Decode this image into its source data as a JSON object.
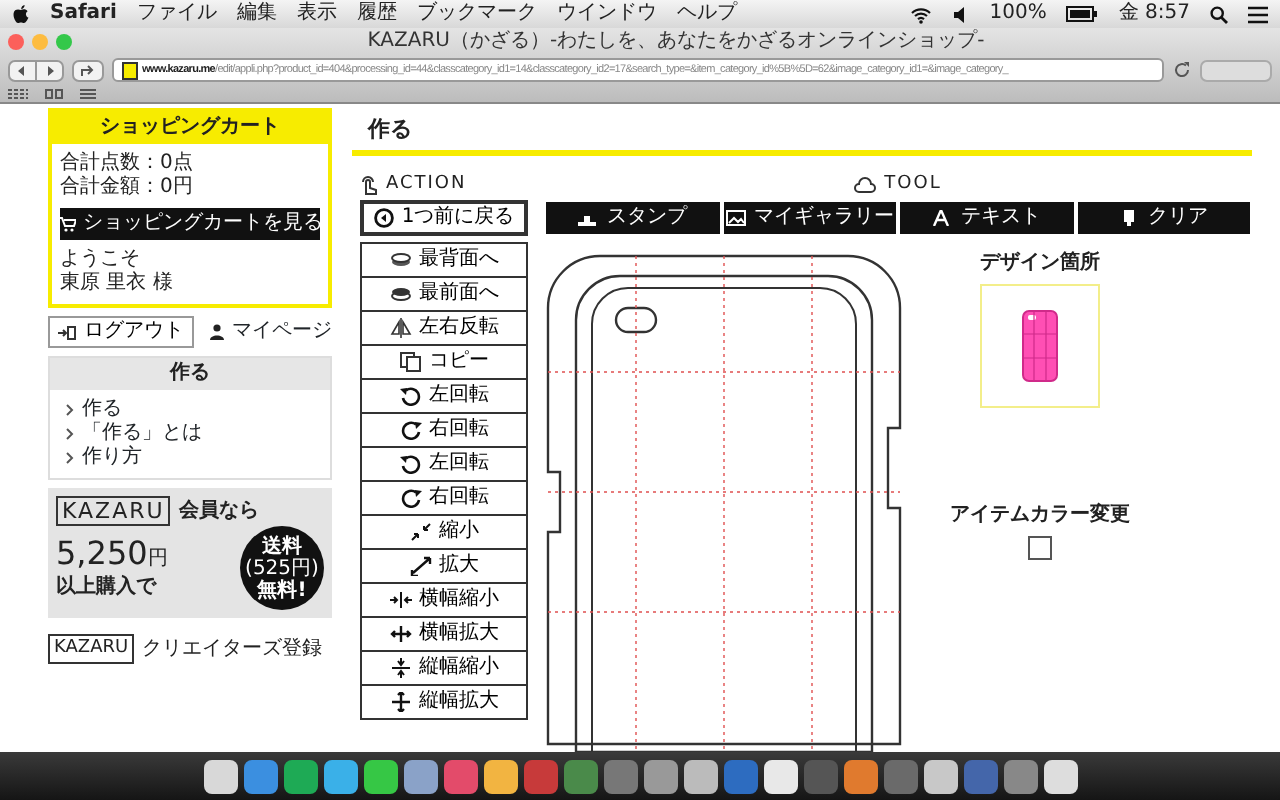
{
  "menu_bar": {
    "items": [
      "Safari",
      "ファイル",
      "編集",
      "表示",
      "履歴",
      "ブックマーク",
      "ウインドウ",
      "ヘルプ"
    ],
    "battery": "100%",
    "clock": "金 8:57"
  },
  "window": {
    "title": "KAZARU（かざる）-わたしを、あなたをかざるオンラインショップ-"
  },
  "address_bar": {
    "host": "www.kazaru.me",
    "path": "/edit/appli.php?product_id=404&processing_id=44&classcategory_id1=14&classcategory_id2=17&search_type=&item_category_id%5B%5D=62&image_category_id1=&image_category_"
  },
  "sidebar": {
    "cart": {
      "title": "ショッピングカート",
      "total_items": "合計点数：0点",
      "total_price": "合計金額：0円",
      "view_button": "ショッピングカートを見る",
      "welcome": "ようこそ",
      "user": "東原 里衣 様"
    },
    "logout": "ログアウト",
    "mypage": "マイページ",
    "menu": {
      "title": "作る",
      "links": [
        "作る",
        "「作る」とは",
        "作り方"
      ]
    },
    "banner": {
      "logo": "KAZARU",
      "member": "会員なら",
      "amount": "5,250",
      "unit": "円",
      "condition": "以上購入で",
      "badge": [
        "送料",
        "(525円)",
        "無料!"
      ]
    },
    "creators": {
      "logo": "KAZARU",
      "label": "クリエイターズ登録"
    }
  },
  "page": {
    "title": "作る"
  },
  "action": {
    "heading": "ACTION",
    "back": "1つ前に戻る",
    "buttons": [
      "最背面へ",
      "最前面へ",
      "左右反転",
      "コピー",
      "左回転",
      "右回転",
      "左回転",
      "右回転",
      "縮小",
      "拡大",
      "横幅縮小",
      "横幅拡大",
      "縦幅縮小",
      "縦幅拡大"
    ]
  },
  "tool": {
    "heading": "TOOL",
    "buttons": [
      "スタンプ",
      "マイギャラリー",
      "テキスト",
      "クリア"
    ]
  },
  "design_panel": {
    "label": "デザイン箇所",
    "color_label": "アイテムカラー変更"
  }
}
